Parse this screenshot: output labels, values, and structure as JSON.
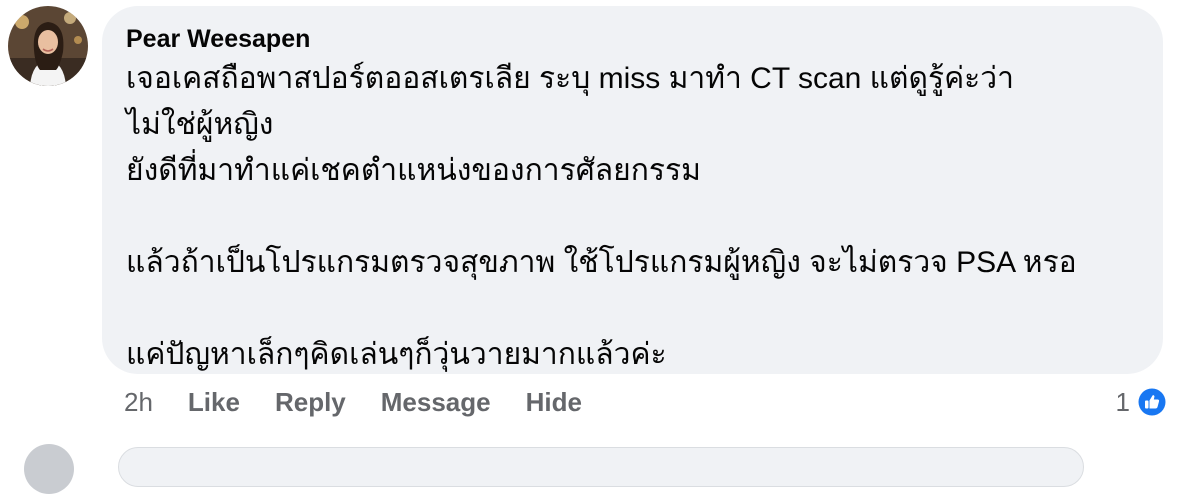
{
  "comment": {
    "author": "Pear Weesapen",
    "lines": [
      "เจอเคสถือพาสปอร์ตออสเตรเลีย ระบุ miss มาทำ CT scan แต่ดูรู้ค่ะว่า",
      "ไม่ใช่ผู้หญิง",
      "ยังดีที่มาทำแค่เชคตำแหน่งของการศัลยกรรม",
      "แล้วถ้าเป็นโปรแกรมตรวจสุขภาพ ใช้โปรแกรมผู้หญิง จะไม่ตรวจ PSA หรอ",
      "แค่ปัญหาเล็กๆคิดเล่นๆก็วุ่นวายมากแล้วค่ะ"
    ]
  },
  "actions": {
    "time": "2h",
    "like": "Like",
    "reply": "Reply",
    "message": "Message",
    "hide": "Hide"
  },
  "reactions": {
    "count": "1",
    "icon": "thumbs-up-icon",
    "color": "#1877f2"
  },
  "colors": {
    "bubble": "#f0f2f5",
    "text": "#050505",
    "secondary": "#65676b"
  }
}
